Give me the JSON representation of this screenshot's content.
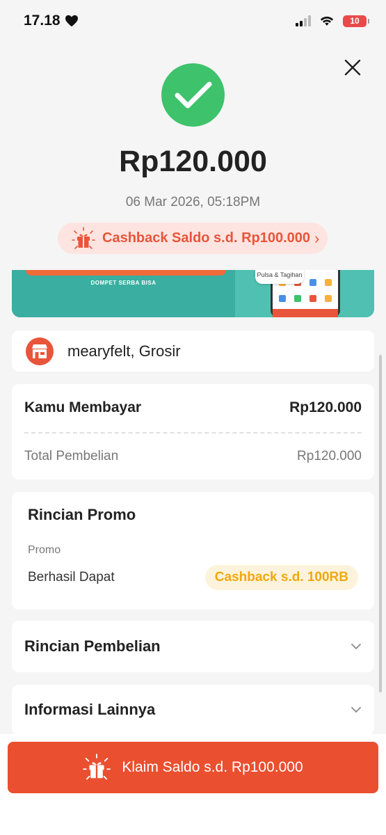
{
  "status_bar": {
    "time": "17.18",
    "battery": "10"
  },
  "success": {
    "amount": "Rp120.000",
    "datetime": "06 Mar 2026, 05:18PM",
    "cashback_pill": "Cashback Saldo s.d. Rp100.000"
  },
  "banner": {
    "left_text": "DOMPET SERBA BISA",
    "phone_chip": "Pulsa & Tagihan"
  },
  "merchant": {
    "name": "mearyfelt, Grosir"
  },
  "payment": {
    "title": "Kamu Membayar",
    "amount": "Rp120.000",
    "total_label": "Total Pembelian",
    "total_value": "Rp120.000"
  },
  "promo": {
    "title": "Rincian Promo",
    "subtitle": "Promo",
    "row_label": "Berhasil Dapat",
    "badge": "Cashback s.d. 100RB"
  },
  "sections": {
    "purchase_details": "Rincian Pembelian",
    "other_info": "Informasi Lainnya"
  },
  "footer": {
    "claim_button": "Klaim Saldo s.d. Rp100.000"
  },
  "colors": {
    "success_green": "#3ec26b",
    "brand_orange": "#ea4f2f",
    "promo_yellow": "#f0a80e",
    "pill_bg": "#fde4e0",
    "banner_teal": "#3aaea0"
  },
  "icons": [
    "heart-icon",
    "signal-icon",
    "wifi-icon",
    "battery-icon",
    "close-icon",
    "check-icon",
    "gift-icon",
    "chevron-right-icon",
    "shop-icon",
    "chevron-down-icon"
  ]
}
